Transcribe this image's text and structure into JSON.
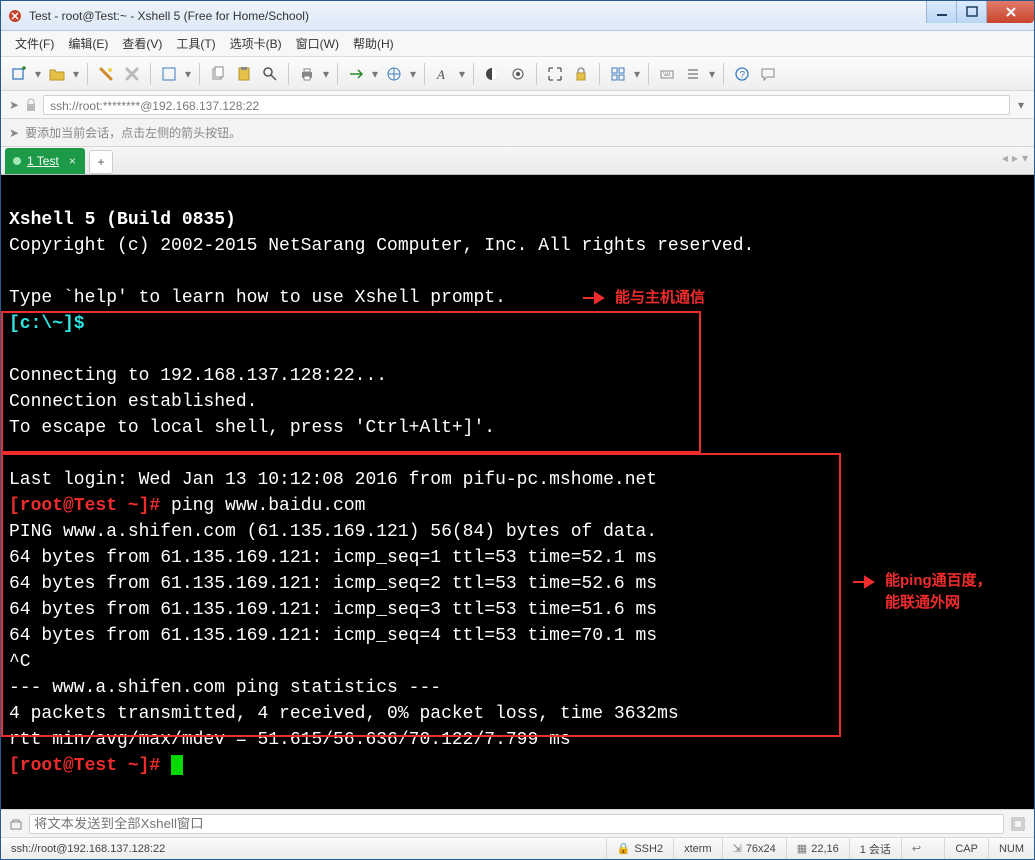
{
  "window": {
    "title": "Test - root@Test:~ - Xshell 5 (Free for Home/School)"
  },
  "menus": {
    "file": "文件(F)",
    "edit": "编辑(E)",
    "view": "查看(V)",
    "tools": "工具(T)",
    "tabs": "选项卡(B)",
    "window": "窗口(W)",
    "help": "帮助(H)"
  },
  "address": {
    "text": "ssh://root:********@192.168.137.128:22"
  },
  "hint": {
    "text": "要添加当前会话，点击左侧的箭头按钮。"
  },
  "tabs": {
    "active": "1 Test"
  },
  "terminal": {
    "header1": "Xshell 5 (Build 0835)",
    "header2": "Copyright (c) 2002-2015 NetSarang Computer, Inc. All rights reserved.",
    "blank1": "",
    "help": "Type `help' to learn how to use Xshell prompt.",
    "localprompt": "[c:\\~]$ ",
    "blank2": "",
    "conn1": "Connecting to 192.168.137.128:22...",
    "conn2": "Connection established.",
    "conn3": "To escape to local shell, press 'Ctrl+Alt+]'.",
    "blank3": "",
    "lastlogin": "Last login: Wed Jan 13 10:12:08 2016 from pifu-pc.mshome.net",
    "rootprompt1a": "[root@Test ~]# ",
    "pingcmd": "ping www.baidu.com",
    "ping1": "PING www.a.shifen.com (61.135.169.121) 56(84) bytes of data.",
    "ping2": "64 bytes from 61.135.169.121: icmp_seq=1 ttl=53 time=52.1 ms",
    "ping3": "64 bytes from 61.135.169.121: icmp_seq=2 ttl=53 time=52.6 ms",
    "ping4": "64 bytes from 61.135.169.121: icmp_seq=3 ttl=53 time=51.6 ms",
    "ping5": "64 bytes from 61.135.169.121: icmp_seq=4 ttl=53 time=70.1 ms",
    "ctrlc": "^C",
    "stats1": "--- www.a.shifen.com ping statistics ---",
    "stats2": "4 packets transmitted, 4 received, 0% packet loss, time 3632ms",
    "stats3": "rtt min/avg/max/mdev = 51.615/56.636/70.122/7.799 ms",
    "rootprompt2": "[root@Test ~]# "
  },
  "annotations": {
    "host": "能与主机通信",
    "baidu1": "能ping通百度，",
    "baidu2": "能联通外网"
  },
  "sendbar": {
    "placeholder": "将文本发送到全部Xshell窗口"
  },
  "status": {
    "path": "ssh://root@192.168.137.128:22",
    "proto": "SSH2",
    "term": "xterm",
    "size": "76x24",
    "pos": "22,16",
    "sess": "1 会话",
    "cap": "CAP",
    "num": "NUM"
  }
}
